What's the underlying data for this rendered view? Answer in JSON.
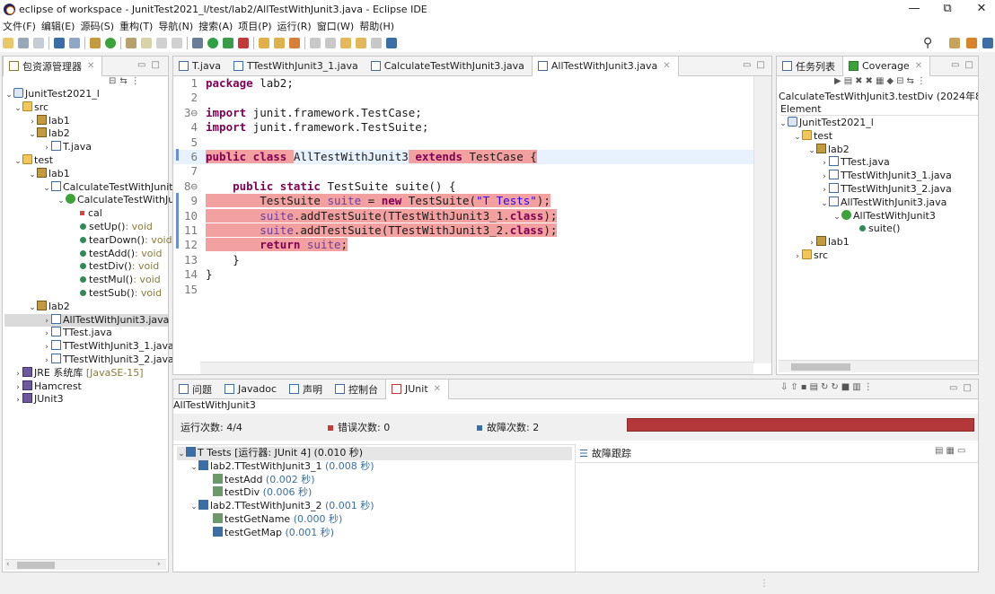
{
  "window": {
    "title": "eclipse of workspace - JunitTest2021_l/test/lab2/AllTestWithJunit3.java - Eclipse IDE",
    "minimize": "—",
    "restore": "⧉",
    "close": "✕"
  },
  "menu": [
    "文件(F)",
    "编辑(E)",
    "源码(S)",
    "重构(T)",
    "导航(N)",
    "搜索(A)",
    "项目(P)",
    "运行(R)",
    "窗口(W)",
    "帮助(H)"
  ],
  "package_explorer": {
    "tab_label": "包资源管理器",
    "rows": [
      {
        "text": "JunitTest2021_l",
        "icon": "project-icon"
      },
      {
        "text": "src",
        "icon": "source-folder-icon"
      },
      {
        "text": "lab1",
        "icon": "package-icon"
      },
      {
        "text": "lab2",
        "icon": "package-icon"
      },
      {
        "text": "T.java",
        "icon": "java-file-icon"
      },
      {
        "text": "test",
        "icon": "source-folder-icon"
      },
      {
        "text": "lab1",
        "icon": "package-icon"
      },
      {
        "text": "CalculateTestWithJunit",
        "icon": "java-file-icon"
      },
      {
        "text": "CalculateTestWithJu",
        "icon": "class-icon"
      },
      {
        "text": "cal",
        "icon": "field-icon"
      },
      {
        "text": "setUp()",
        "suffix": ": void",
        "icon": "method-icon"
      },
      {
        "text": "tearDown()",
        "suffix": ": void",
        "icon": "method-icon"
      },
      {
        "text": "testAdd()",
        "suffix": ": void",
        "icon": "method-icon"
      },
      {
        "text": "testDiv()",
        "suffix": ": void",
        "icon": "method-icon"
      },
      {
        "text": "testMul()",
        "suffix": ": void",
        "icon": "method-icon"
      },
      {
        "text": "testSub()",
        "suffix": ": void",
        "icon": "method-icon"
      },
      {
        "text": "lab2",
        "icon": "package-icon"
      },
      {
        "text": "AllTestWithJunit3.java",
        "icon": "java-file-icon"
      },
      {
        "text": "TTest.java",
        "icon": "java-file-icon"
      },
      {
        "text": "TTestWithJunit3_1.java",
        "icon": "java-file-icon"
      },
      {
        "text": "TTestWithJunit3_2.java",
        "icon": "java-file-icon"
      },
      {
        "text": "JRE 系统库",
        "suffix": "[JavaSE-15]",
        "icon": "library-icon"
      },
      {
        "text": "Hamcrest",
        "icon": "library-icon"
      },
      {
        "text": "JUnit3",
        "icon": "library-icon"
      }
    ]
  },
  "editor": {
    "tabs": [
      "T.java",
      "TTestWithJunit3_1.java",
      "CalculateTestWithJunit3.java",
      "AllTestWithJunit3.java"
    ],
    "lines": [
      {
        "n": "1",
        "t": "package lab2;"
      },
      {
        "n": "2",
        "t": ""
      },
      {
        "n": "3⊖",
        "t": "import junit.framework.TestCase;"
      },
      {
        "n": "4",
        "t": "import junit.framework.TestSuite;"
      },
      {
        "n": "5",
        "t": ""
      },
      {
        "n": "6",
        "t": "public class AllTestWithJunit3 extends TestCase {"
      },
      {
        "n": "7",
        "t": ""
      },
      {
        "n": "8⊖",
        "t": "    public static TestSuite suite() {"
      },
      {
        "n": "9",
        "t": "        TestSuite suite = new TestSuite(\"T Tests\");"
      },
      {
        "n": "10",
        "t": "        suite.addTestSuite(TTestWithJunit3_1.class);"
      },
      {
        "n": "11",
        "t": "        suite.addTestSuite(TTestWithJunit3_2.class);"
      },
      {
        "n": "12",
        "t": "        return suite;"
      },
      {
        "n": "13",
        "t": "    }"
      },
      {
        "n": "14",
        "t": "}"
      },
      {
        "n": "15",
        "t": ""
      }
    ]
  },
  "coverage": {
    "tabs": [
      "任务列表",
      "Coverage"
    ],
    "session": "CalculateTestWithJunit3.testDiv (2024年8月2",
    "column": "Element",
    "rows": [
      "JunitTest2021_l",
      "test",
      "lab2",
      "TTest.java",
      "TTestWithJunit3_1.java",
      "TTestWithJunit3_2.java",
      "AllTestWithJunit3.java",
      "AllTestWithJunit3",
      "suite()",
      "lab1",
      "src"
    ]
  },
  "bottom": {
    "tabs": [
      "问题",
      "Javadoc",
      "声明",
      "控制台",
      "JUnit"
    ],
    "context": "AllTestWithJunit3",
    "runs_label": "运行次数:",
    "runs_value": "4/4",
    "errors_label": "错误次数:",
    "errors_value": "0",
    "failures_label": "故障次数:",
    "failures_value": "2",
    "failure_trace_label": "故障跟踪",
    "results": [
      {
        "name": "T Tests [运行器: JUnit 4]",
        "time": "(0.010 秒)"
      },
      {
        "name": "lab2.TTestWithJunit3_1",
        "time": "(0.008 秒)"
      },
      {
        "name": "testAdd",
        "time": "(0.002 秒)"
      },
      {
        "name": "testDiv",
        "time": "(0.006 秒)"
      },
      {
        "name": "lab2.TTestWithJunit3_2",
        "time": "(0.001 秒)"
      },
      {
        "name": "testGetName",
        "time": "(0.000 秒)"
      },
      {
        "name": "testGetMap",
        "time": "(0.001 秒)"
      }
    ]
  },
  "colors": {
    "failure_bar": "#b4383a",
    "highlight": "#f2a0a0",
    "keyword": "#7f0055",
    "string": "#2a00ff"
  }
}
